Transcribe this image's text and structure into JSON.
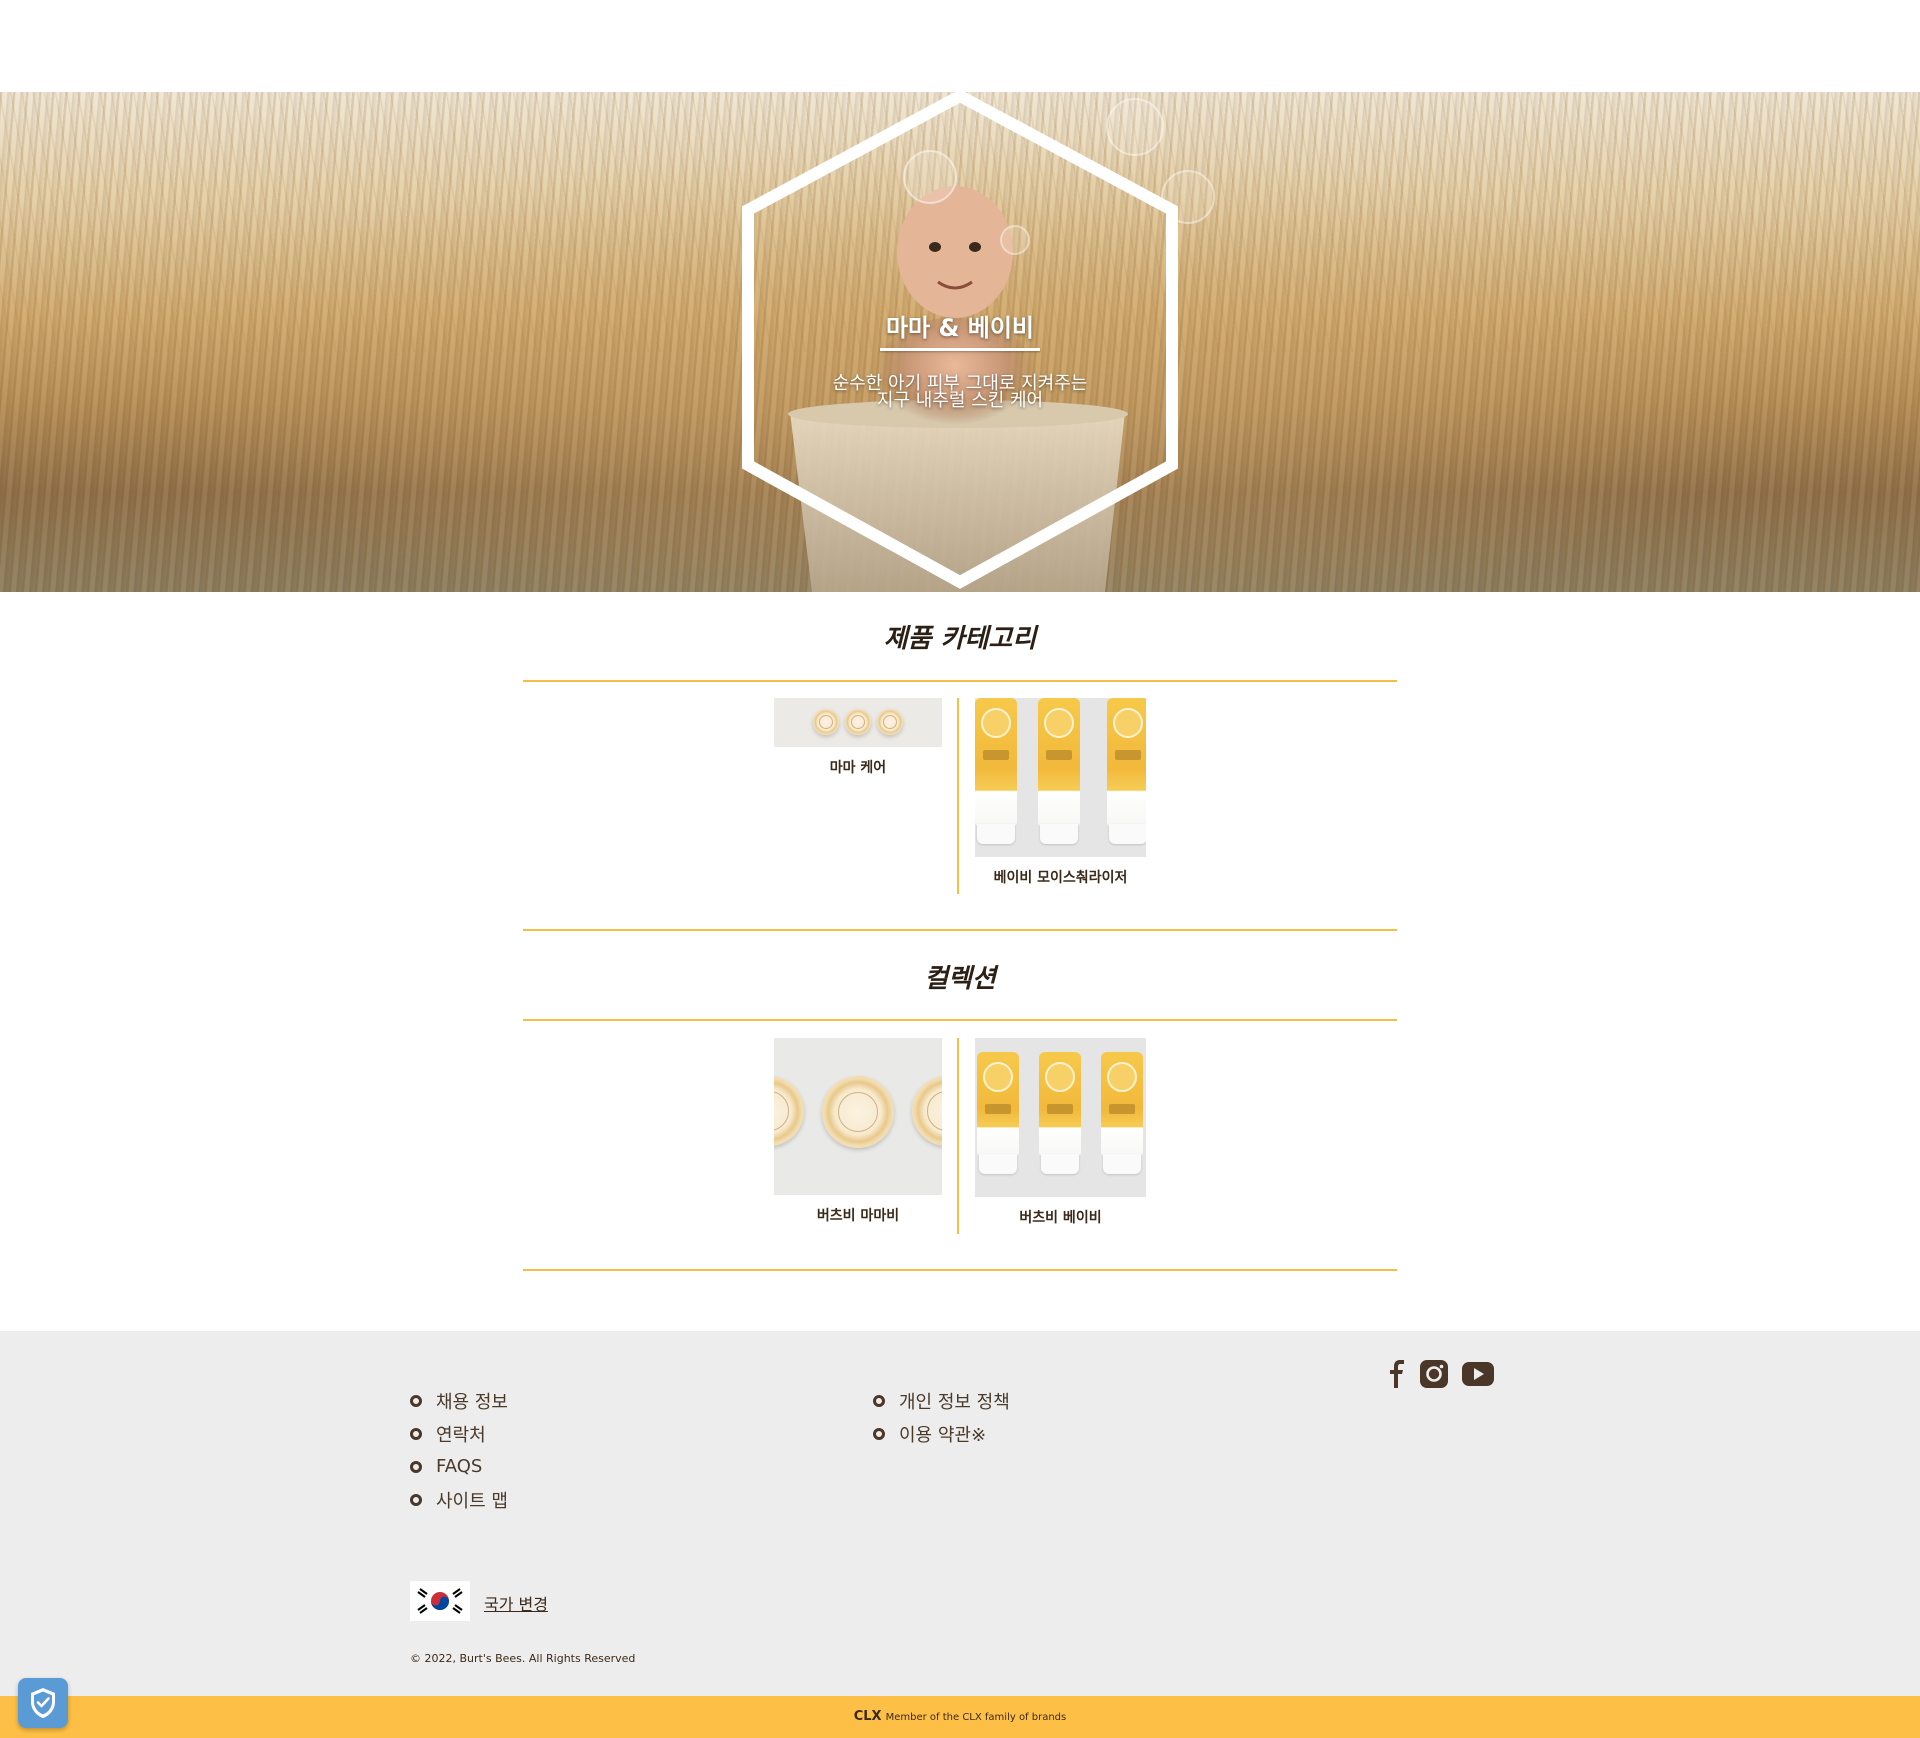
{
  "hero": {
    "title": "마마 & 베이비",
    "subtitle_line1": "순수한 아기 피부 그대로 지켜주는",
    "subtitle_line2": "지구 내추럴 스킨 케어"
  },
  "categories": {
    "title": "제품 카테고리",
    "items": [
      {
        "label": "마마 케어"
      },
      {
        "label": "베이비 모이스춰라이저"
      }
    ]
  },
  "collections": {
    "title": "컬렉션",
    "items": [
      {
        "label": "버츠비 마마비"
      },
      {
        "label": "버츠비 베이비"
      }
    ]
  },
  "footer": {
    "links_col1": [
      "채용 정보",
      "연락처",
      "FAQS",
      "사이트 맵"
    ],
    "links_col2": [
      "개인 정보 정책",
      "이용 약관※"
    ],
    "social_icons": [
      "facebook-icon",
      "instagram-icon",
      "youtube-icon"
    ],
    "country_change": "국가 변경",
    "copyright": "© 2022, Burt's Bees. All Rights Reserved"
  },
  "bottom_bar": {
    "brand": "CLX",
    "text": "Member of the CLX family of brands"
  },
  "colors": {
    "accent": "#f5bf45",
    "bottom_bar": "#fdbf45",
    "footer_bg": "#ededed",
    "text": "#3b2a1a"
  }
}
